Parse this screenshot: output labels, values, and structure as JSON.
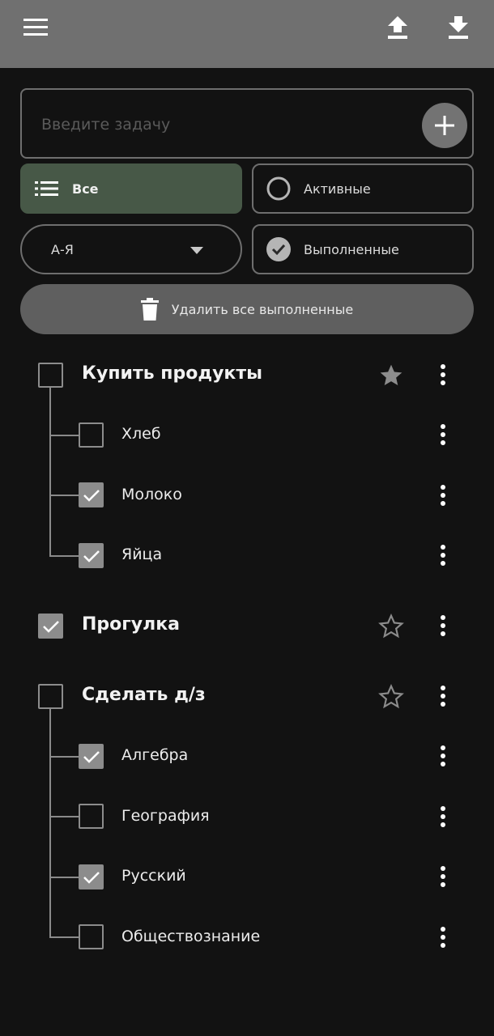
{
  "appbar": {
    "menu_icon": "menu-icon",
    "upload_icon": "upload-icon",
    "download_icon": "download-icon",
    "bg_color": "#707070"
  },
  "task_input": {
    "placeholder": "Введите задачу",
    "value": "",
    "add_icon": "plus-icon"
  },
  "filters": {
    "all_label": "Все",
    "active_label": "Активные",
    "done_label": "Выполненные",
    "selected": "Все",
    "selected_color": "#475847"
  },
  "sort": {
    "selected": "А-Я"
  },
  "delete_done_label": "Удалить все выполненные",
  "tasks": [
    {
      "title": "Купить продукты",
      "checked": false,
      "starred": true,
      "subtasks": [
        {
          "title": "Хлеб",
          "checked": false
        },
        {
          "title": "Молоко",
          "checked": true
        },
        {
          "title": "Яйца",
          "checked": true
        }
      ]
    },
    {
      "title": "Прогулка",
      "checked": true,
      "starred": false,
      "subtasks": []
    },
    {
      "title": "Сделать д/з",
      "checked": false,
      "starred": false,
      "subtasks": [
        {
          "title": "Алгебра",
          "checked": true
        },
        {
          "title": "География",
          "checked": false
        },
        {
          "title": "Русский",
          "checked": true
        },
        {
          "title": "Обществознание",
          "checked": false
        }
      ]
    }
  ]
}
